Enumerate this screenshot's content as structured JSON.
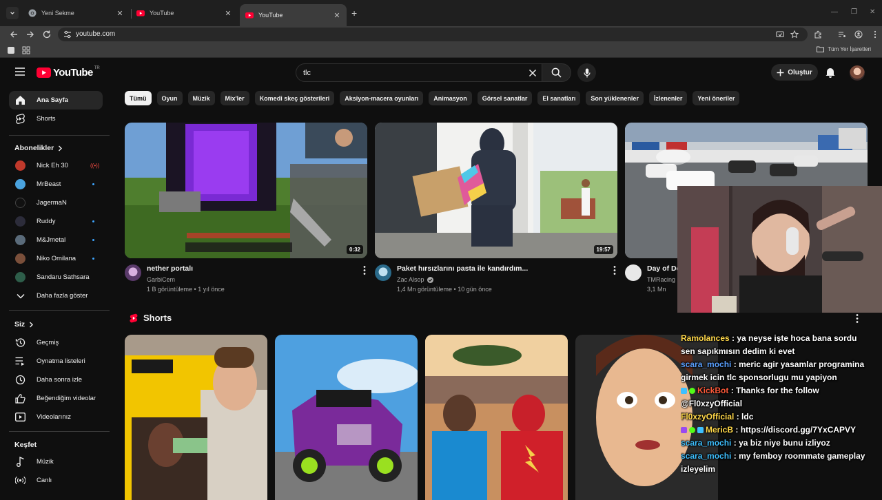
{
  "browser": {
    "tabs": [
      {
        "title": "Yeni Sekme",
        "icon": "chrome-icon",
        "active": false
      },
      {
        "title": "YouTube",
        "icon": "youtube-icon",
        "active": false
      },
      {
        "title": "YouTube",
        "icon": "youtube-icon",
        "active": true
      }
    ],
    "url": "youtube.com",
    "bookmarks_all": "Tüm Yer İşaretleri"
  },
  "youtube": {
    "logo_text": "YouTube",
    "country_code": "TR",
    "search_query": "tlc",
    "create_label": "Oluştur",
    "sidebar": {
      "main": [
        {
          "label": "Ana Sayfa",
          "icon": "home-icon",
          "active": true
        },
        {
          "label": "Shorts",
          "icon": "shorts-icon",
          "active": false
        }
      ],
      "subscriptions_title": "Abonelikler",
      "subscriptions": [
        {
          "label": "Nick Eh 30",
          "color": "#c0392b",
          "indicator": "live"
        },
        {
          "label": "MrBeast",
          "color": "#4aa3df",
          "indicator": "dot"
        },
        {
          "label": "JagermaN",
          "color": "#111111",
          "indicator": ""
        },
        {
          "label": "Ruddy",
          "color": "#2c2c3a",
          "indicator": "dot"
        },
        {
          "label": "M&Jmetal",
          "color": "#5a6b7a",
          "indicator": "dot"
        },
        {
          "label": "Niko Omilana",
          "color": "#7a4f3a",
          "indicator": "dot"
        },
        {
          "label": "Sandaru Sathsara",
          "color": "#2e5e4a",
          "indicator": ""
        }
      ],
      "show_more": "Daha fazla göster",
      "you_title": "Siz",
      "you_items": [
        {
          "label": "Geçmiş",
          "icon": "history-icon"
        },
        {
          "label": "Oynatma listeleri",
          "icon": "playlists-icon"
        },
        {
          "label": "Daha sonra izle",
          "icon": "watch-later-icon"
        },
        {
          "label": "Beğendiğim videolar",
          "icon": "like-icon"
        },
        {
          "label": "Videolarınız",
          "icon": "your-videos-icon"
        }
      ],
      "explore_title": "Keşfet",
      "explore_items": [
        {
          "label": "Müzik",
          "icon": "music-icon"
        },
        {
          "label": "Canlı",
          "icon": "live-icon"
        }
      ]
    },
    "chips": [
      "Tümü",
      "Oyun",
      "Müzik",
      "Mix'ler",
      "Komedi skeç gösterileri",
      "Aksiyon-macera oyunları",
      "Animasyon",
      "Görsel sanatlar",
      "El sanatları",
      "Son yüklenenler",
      "İzlenenler",
      "Yeni öneriler"
    ],
    "videos": [
      {
        "title": "nether portalı",
        "channel": "GarbiCem",
        "verified": false,
        "stats": "1 B görüntüleme • 1 yıl önce",
        "duration": "0:32"
      },
      {
        "title": "Paket hırsızlarını pasta ile kandırdım...",
        "channel": "Zac Alsop",
        "verified": true,
        "stats": "1,4 Mn görüntüleme • 10 gün önce",
        "duration": "19:57"
      },
      {
        "title": "Day of De",
        "channel": "TMRacing",
        "verified": false,
        "stats": "3,1 Mn",
        "duration": ""
      }
    ],
    "shorts_title": "Shorts"
  },
  "overlay": {
    "chat": [
      {
        "user": "Ramolances",
        "msg": ": ya neyse işte hoca bana sordu"
      },
      {
        "user": "",
        "msg": "sen sapıkmısın dedim ki evet"
      },
      {
        "user": "scara_mochi",
        "msg": ": meric agir yasamlar programina"
      },
      {
        "user": "",
        "msg": "girmek icin tlc sponsorlugu mu yapiyon"
      },
      {
        "user": "KickBot",
        "msg": ": Thanks for the follow"
      },
      {
        "user": "",
        "msg": "@Fl0xzyOfficial"
      },
      {
        "user": "Fl0xzyOfficial",
        "msg": ": ldc"
      },
      {
        "user": "MericB",
        "msg": ": https://discord.gg/7YxCAPVY"
      },
      {
        "user": "scara_mochi",
        "msg": ": ya biz niye bunu izliyoz"
      },
      {
        "user": "scara_mochi",
        "msg": ": my femboy roommate gameplay"
      },
      {
        "user": "",
        "msg": "izleyelim"
      }
    ]
  }
}
